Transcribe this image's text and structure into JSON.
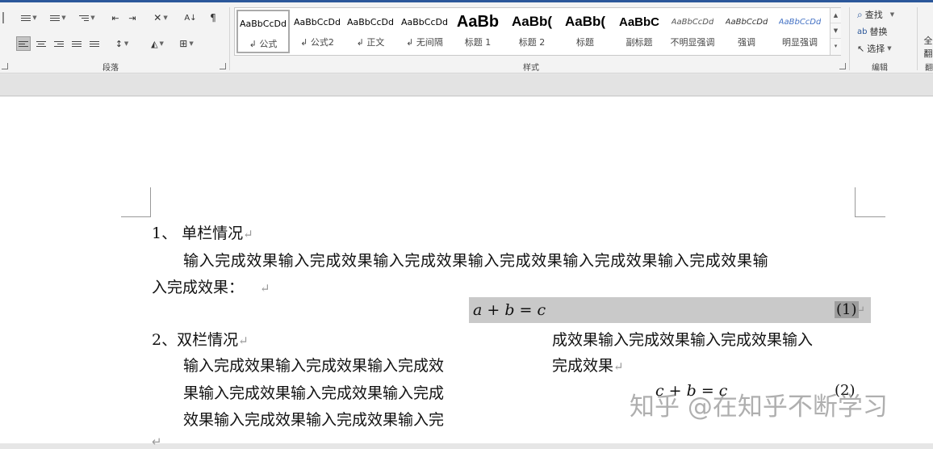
{
  "ribbon": {
    "paragraph_label": "段落",
    "styles_label": "样式",
    "editing_label": "编辑",
    "sort_label": "A↓",
    "styles": [
      {
        "sample": "AaBbCcDd",
        "name": "↲ 公式"
      },
      {
        "sample": "AaBbCcDd",
        "name": "↲ 公式2"
      },
      {
        "sample": "AaBbCcDd",
        "name": "↲ 正文"
      },
      {
        "sample": "AaBbCcDd",
        "name": "↲ 无间隔"
      },
      {
        "sample": "AaBb",
        "name": "标题 1"
      },
      {
        "sample": "AaBb(",
        "name": "标题 2"
      },
      {
        "sample": "AaBb(",
        "name": "标题"
      },
      {
        "sample": "AaBbC",
        "name": "副标题"
      },
      {
        "sample": "AaBbCcDd",
        "name": "不明显强调"
      },
      {
        "sample": "AaBbCcDd",
        "name": "强调"
      },
      {
        "sample": "AaBbCcDd",
        "name": "明显强调"
      }
    ],
    "editing": {
      "find": "查找",
      "replace": "替换",
      "select": "选择"
    },
    "right_cut_1": "全",
    "right_cut_2": "翻",
    "right_cut_3": "翻"
  },
  "document": {
    "h1": "1、 单栏情况",
    "p1_line1": "输入完成效果输入完成效果输入完成效果输入完成效果输入完成效果输入完成效果输",
    "p1_line2": "入完成效果：",
    "eq1": "a + b = c",
    "eq1_num": "(1)",
    "h2": "2、双栏情况",
    "left_col": [
      "输入完成效果输入完成效果输入完成效",
      "果输入完成效果输入完成效果输入完成",
      "效果输入完成效果输入完成效果输入完"
    ],
    "right_col": [
      "成效果输入完成效果输入完成效果输入",
      "完成效果"
    ],
    "eq2": "c + b = c",
    "eq2_num": "(2)",
    "return_mark": "↵"
  },
  "watermark": "知乎 @在知乎不断学习",
  "colors": {
    "accent": "#2b579a",
    "equation_highlight": "#c9c9c9"
  }
}
